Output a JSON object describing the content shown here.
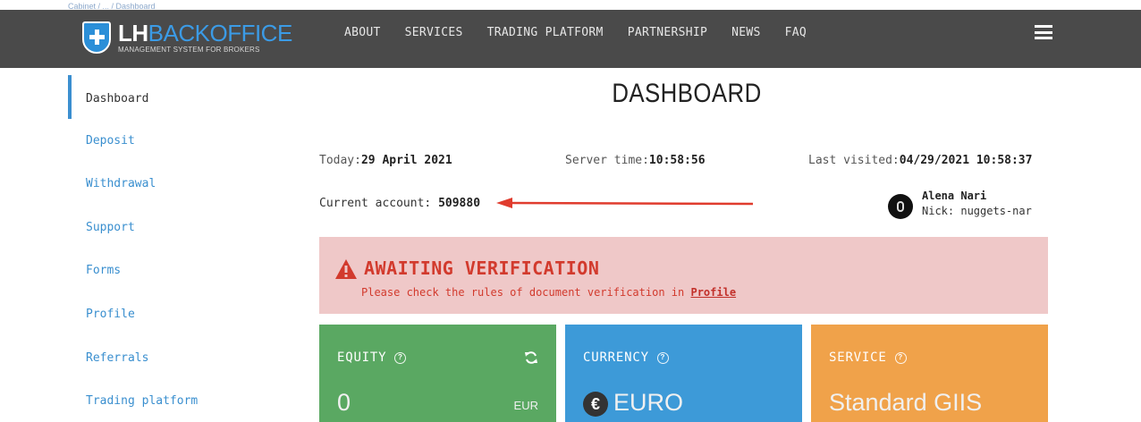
{
  "breadcrumb": "Cabinet / ... / Dashboard",
  "logo": {
    "lh": "LH",
    "backoffice": "BACKOFFICE",
    "tagline": "MANAGEMENT SYSTEM FOR BROKERS"
  },
  "nav": [
    "ABOUT",
    "SERVICES",
    "TRADING PLATFORM",
    "PARTNERSHIP",
    "NEWS",
    "FAQ"
  ],
  "sidebar": {
    "items": [
      {
        "label": "Dashboard",
        "active": true
      },
      {
        "label": "Deposit"
      },
      {
        "label": "Withdrawal"
      },
      {
        "label": "Support"
      },
      {
        "label": "Forms"
      },
      {
        "label": "Profile"
      },
      {
        "label": "Referrals"
      },
      {
        "label": "Trading platform"
      }
    ]
  },
  "main": {
    "title": "DASHBOARD",
    "today_label": "Today:",
    "today": "29 April 2021",
    "server_time_label": "Server time:",
    "server_time": "10:58:56",
    "last_visited_label": "Last visited:",
    "last_visited": "04/29/2021 10:58:37",
    "account_label": "Current account: ",
    "account": "509880"
  },
  "user": {
    "name": "Alena Nari",
    "nick": "Nick: nuggets-nar"
  },
  "alert": {
    "title": "AWAITING VERIFICATION",
    "text": "Please check the rules of document verification in ",
    "link": "Profile"
  },
  "cards": {
    "equity": {
      "title": "EQUITY",
      "value": "0",
      "currency": "EUR",
      "color": "#5aa862"
    },
    "currency": {
      "title": "CURRENCY",
      "value": "EURO",
      "symbol": "€",
      "color": "#3d9ad8"
    },
    "service": {
      "title": "SERVICE",
      "value": "Standard GIIS",
      "color": "#f0a24a"
    }
  },
  "colors": {
    "header": "#4a4a4a",
    "accent": "#3a8fcf",
    "alert_bg": "#efc8c8",
    "alert_text": "#d23a2d",
    "arrow": "#e03c2e"
  },
  "icons": [
    "shield-plus-icon",
    "menu-icon",
    "warning-icon",
    "help-icon",
    "refresh-icon",
    "euro-icon",
    "avatar"
  ]
}
